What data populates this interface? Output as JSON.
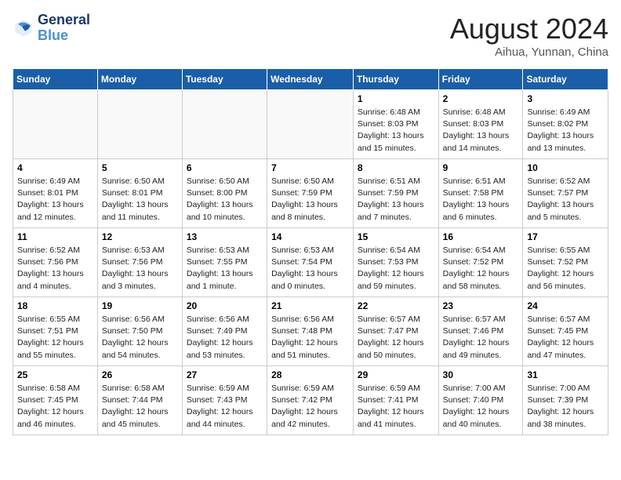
{
  "header": {
    "logo_line1": "General",
    "logo_line2": "Blue",
    "title": "August 2024",
    "subtitle": "Aihua, Yunnan, China"
  },
  "days_of_week": [
    "Sunday",
    "Monday",
    "Tuesday",
    "Wednesday",
    "Thursday",
    "Friday",
    "Saturday"
  ],
  "weeks": [
    [
      {
        "day": "",
        "info": ""
      },
      {
        "day": "",
        "info": ""
      },
      {
        "day": "",
        "info": ""
      },
      {
        "day": "",
        "info": ""
      },
      {
        "day": "1",
        "info": "Sunrise: 6:48 AM\nSunset: 8:03 PM\nDaylight: 13 hours\nand 15 minutes."
      },
      {
        "day": "2",
        "info": "Sunrise: 6:48 AM\nSunset: 8:03 PM\nDaylight: 13 hours\nand 14 minutes."
      },
      {
        "day": "3",
        "info": "Sunrise: 6:49 AM\nSunset: 8:02 PM\nDaylight: 13 hours\nand 13 minutes."
      }
    ],
    [
      {
        "day": "4",
        "info": "Sunrise: 6:49 AM\nSunset: 8:01 PM\nDaylight: 13 hours\nand 12 minutes."
      },
      {
        "day": "5",
        "info": "Sunrise: 6:50 AM\nSunset: 8:01 PM\nDaylight: 13 hours\nand 11 minutes."
      },
      {
        "day": "6",
        "info": "Sunrise: 6:50 AM\nSunset: 8:00 PM\nDaylight: 13 hours\nand 10 minutes."
      },
      {
        "day": "7",
        "info": "Sunrise: 6:50 AM\nSunset: 7:59 PM\nDaylight: 13 hours\nand 8 minutes."
      },
      {
        "day": "8",
        "info": "Sunrise: 6:51 AM\nSunset: 7:59 PM\nDaylight: 13 hours\nand 7 minutes."
      },
      {
        "day": "9",
        "info": "Sunrise: 6:51 AM\nSunset: 7:58 PM\nDaylight: 13 hours\nand 6 minutes."
      },
      {
        "day": "10",
        "info": "Sunrise: 6:52 AM\nSunset: 7:57 PM\nDaylight: 13 hours\nand 5 minutes."
      }
    ],
    [
      {
        "day": "11",
        "info": "Sunrise: 6:52 AM\nSunset: 7:56 PM\nDaylight: 13 hours\nand 4 minutes."
      },
      {
        "day": "12",
        "info": "Sunrise: 6:53 AM\nSunset: 7:56 PM\nDaylight: 13 hours\nand 3 minutes."
      },
      {
        "day": "13",
        "info": "Sunrise: 6:53 AM\nSunset: 7:55 PM\nDaylight: 13 hours\nand 1 minute."
      },
      {
        "day": "14",
        "info": "Sunrise: 6:53 AM\nSunset: 7:54 PM\nDaylight: 13 hours\nand 0 minutes."
      },
      {
        "day": "15",
        "info": "Sunrise: 6:54 AM\nSunset: 7:53 PM\nDaylight: 12 hours\nand 59 minutes."
      },
      {
        "day": "16",
        "info": "Sunrise: 6:54 AM\nSunset: 7:52 PM\nDaylight: 12 hours\nand 58 minutes."
      },
      {
        "day": "17",
        "info": "Sunrise: 6:55 AM\nSunset: 7:52 PM\nDaylight: 12 hours\nand 56 minutes."
      }
    ],
    [
      {
        "day": "18",
        "info": "Sunrise: 6:55 AM\nSunset: 7:51 PM\nDaylight: 12 hours\nand 55 minutes."
      },
      {
        "day": "19",
        "info": "Sunrise: 6:56 AM\nSunset: 7:50 PM\nDaylight: 12 hours\nand 54 minutes."
      },
      {
        "day": "20",
        "info": "Sunrise: 6:56 AM\nSunset: 7:49 PM\nDaylight: 12 hours\nand 53 minutes."
      },
      {
        "day": "21",
        "info": "Sunrise: 6:56 AM\nSunset: 7:48 PM\nDaylight: 12 hours\nand 51 minutes."
      },
      {
        "day": "22",
        "info": "Sunrise: 6:57 AM\nSunset: 7:47 PM\nDaylight: 12 hours\nand 50 minutes."
      },
      {
        "day": "23",
        "info": "Sunrise: 6:57 AM\nSunset: 7:46 PM\nDaylight: 12 hours\nand 49 minutes."
      },
      {
        "day": "24",
        "info": "Sunrise: 6:57 AM\nSunset: 7:45 PM\nDaylight: 12 hours\nand 47 minutes."
      }
    ],
    [
      {
        "day": "25",
        "info": "Sunrise: 6:58 AM\nSunset: 7:45 PM\nDaylight: 12 hours\nand 46 minutes."
      },
      {
        "day": "26",
        "info": "Sunrise: 6:58 AM\nSunset: 7:44 PM\nDaylight: 12 hours\nand 45 minutes."
      },
      {
        "day": "27",
        "info": "Sunrise: 6:59 AM\nSunset: 7:43 PM\nDaylight: 12 hours\nand 44 minutes."
      },
      {
        "day": "28",
        "info": "Sunrise: 6:59 AM\nSunset: 7:42 PM\nDaylight: 12 hours\nand 42 minutes."
      },
      {
        "day": "29",
        "info": "Sunrise: 6:59 AM\nSunset: 7:41 PM\nDaylight: 12 hours\nand 41 minutes."
      },
      {
        "day": "30",
        "info": "Sunrise: 7:00 AM\nSunset: 7:40 PM\nDaylight: 12 hours\nand 40 minutes."
      },
      {
        "day": "31",
        "info": "Sunrise: 7:00 AM\nSunset: 7:39 PM\nDaylight: 12 hours\nand 38 minutes."
      }
    ]
  ]
}
